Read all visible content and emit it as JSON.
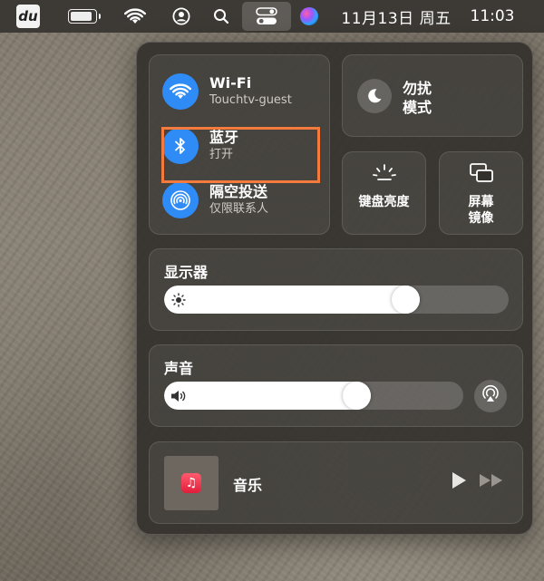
{
  "menubar": {
    "app_icon_text": "du",
    "date": "11月13日 周五",
    "time": "11:03"
  },
  "control_center": {
    "wifi": {
      "title": "Wi-Fi",
      "subtitle": "Touchtv-guest",
      "icon": "wifi-icon"
    },
    "bluetooth": {
      "title": "蓝牙",
      "subtitle": "打开",
      "icon": "bluetooth-icon"
    },
    "airdrop": {
      "title": "隔空投送",
      "subtitle": "仅限联系人",
      "icon": "airdrop-icon"
    },
    "dnd": {
      "title_line1": "勿扰",
      "title_line2": "模式",
      "icon": "moon-icon"
    },
    "keyboard_brightness": {
      "label": "键盘亮度",
      "icon": "keyboard-brightness-icon"
    },
    "screen_mirroring": {
      "label_line1": "屏幕",
      "label_line2": "镜像",
      "icon": "screen-mirroring-icon"
    },
    "display": {
      "title": "显示器",
      "level": 0.72,
      "icon": "sun-icon"
    },
    "sound": {
      "title": "声音",
      "level": 0.66,
      "icon": "speaker-icon"
    },
    "now_playing": {
      "label": "音乐",
      "icon": "music-app-icon"
    }
  },
  "colors": {
    "accent_blue": "#2f8cf7",
    "highlight_orange": "#f47b3d",
    "menubar_bg": "#3d3a36"
  }
}
